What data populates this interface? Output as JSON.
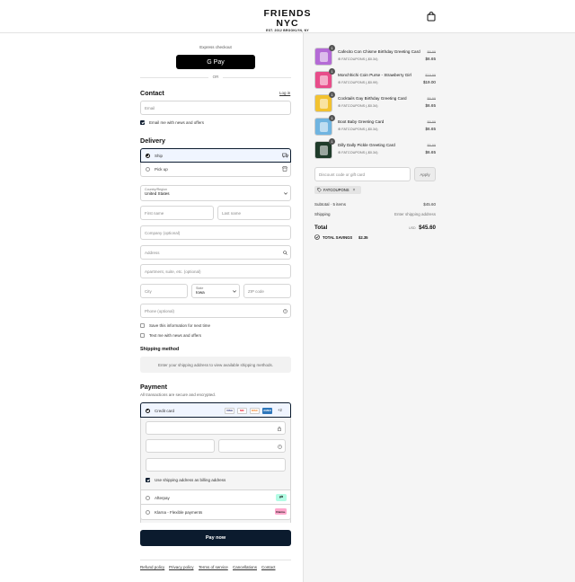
{
  "brand": {
    "name": "FRIENDS NYC",
    "tagline": "EST. 2012 BROOKLYN, NY"
  },
  "express": {
    "title": "Express checkout",
    "gpay_label": "G Pay",
    "or": "OR"
  },
  "contact": {
    "title": "Contact",
    "login": "Log in",
    "email_placeholder": "Email",
    "newsletter": "Email me with news and offers"
  },
  "delivery": {
    "title": "Delivery",
    "options": [
      {
        "label": "Ship",
        "selected": true
      },
      {
        "label": "Pick up",
        "selected": false
      }
    ],
    "country_label": "Country/Region",
    "country_value": "United States",
    "first_name": "First name",
    "last_name": "Last name",
    "company": "Company (optional)",
    "address": "Address",
    "apartment": "Apartment, suite, etc. (optional)",
    "city": "City",
    "state_label": "State",
    "state_value": "Iowa",
    "zip": "ZIP code",
    "phone": "Phone (optional)",
    "save_info": "Save this information for next time",
    "text_me": "Text me with news and offers"
  },
  "shipping_method": {
    "title": "Shipping method",
    "message": "Enter your shipping address to view available shipping methods."
  },
  "payment": {
    "title": "Payment",
    "subtitle": "All transactions are secure and encrypted.",
    "credit_card": "Credit card",
    "cards": [
      "VISA",
      "MC",
      "DISC",
      "AMEX"
    ],
    "more_cards": "+2",
    "billing_same": "Use shipping address as billing address",
    "afterpay": "Afterpay",
    "klarna": "Klarna - Flexible payments",
    "klarna_logo": "Klarna."
  },
  "pay_now": "Pay now",
  "footer_links": [
    "Refund policy",
    "Privacy policy",
    "Terms of service",
    "Cancellations",
    "Contact"
  ],
  "items": [
    {
      "name": "Cafecito Con Chisme Birthday Greeting Card",
      "discount": "FATCOUPONS (-$0.34)",
      "old_price": "$6.99",
      "price": "$6.65",
      "qty": "1",
      "color": "#b46ad6"
    },
    {
      "name": "Monchhichi Coin Purse - Strawberry Girl",
      "discount": "FATCOUPONS (-$0.99)",
      "old_price": "$19.99",
      "price": "$19.00",
      "qty": "1",
      "color": "#e84d8a"
    },
    {
      "name": "Cocktails Gay Birthday Greeting Card",
      "discount": "FATCOUPONS (-$0.34)",
      "old_price": "$6.99",
      "price": "$6.65",
      "qty": "1",
      "color": "#f2c230"
    },
    {
      "name": "Boot Baby Greeting Card",
      "discount": "FATCOUPONS (-$0.34)",
      "old_price": "$6.99",
      "price": "$6.65",
      "qty": "1",
      "color": "#6fb4e0"
    },
    {
      "name": "Dilly Dally Pickle Greeting Card",
      "discount": "FATCOUPONS (-$0.34)",
      "old_price": "$6.99",
      "price": "$6.65",
      "qty": "1",
      "color": "#1f3b2a"
    }
  ],
  "discount": {
    "placeholder": "Discount code or gift card",
    "apply": "Apply",
    "tag": "FATCOUPONS"
  },
  "summary": {
    "subtotal_label": "Subtotal · 5 items",
    "subtotal": "$45.60",
    "shipping_label": "Shipping",
    "shipping": "Enter shipping address",
    "total_label": "Total",
    "currency": "USD",
    "total": "$45.60",
    "savings_label": "TOTAL SAVINGS",
    "savings": "$2.35"
  }
}
